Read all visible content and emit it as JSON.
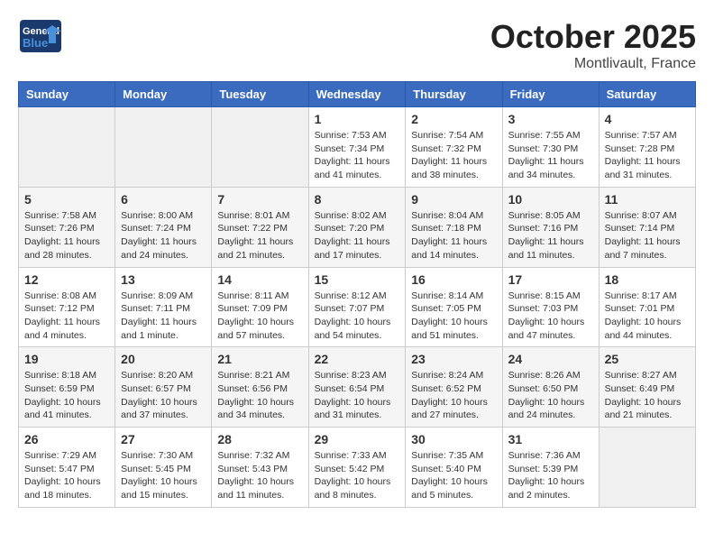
{
  "header": {
    "logo": {
      "general": "General",
      "blue": "Blue"
    },
    "title": "October 2025",
    "location": "Montlivault, France"
  },
  "weekdays": [
    "Sunday",
    "Monday",
    "Tuesday",
    "Wednesday",
    "Thursday",
    "Friday",
    "Saturday"
  ],
  "weeks": [
    [
      {
        "day": "",
        "info": ""
      },
      {
        "day": "",
        "info": ""
      },
      {
        "day": "",
        "info": ""
      },
      {
        "day": "1",
        "info": "Sunrise: 7:53 AM\nSunset: 7:34 PM\nDaylight: 11 hours\nand 41 minutes."
      },
      {
        "day": "2",
        "info": "Sunrise: 7:54 AM\nSunset: 7:32 PM\nDaylight: 11 hours\nand 38 minutes."
      },
      {
        "day": "3",
        "info": "Sunrise: 7:55 AM\nSunset: 7:30 PM\nDaylight: 11 hours\nand 34 minutes."
      },
      {
        "day": "4",
        "info": "Sunrise: 7:57 AM\nSunset: 7:28 PM\nDaylight: 11 hours\nand 31 minutes."
      }
    ],
    [
      {
        "day": "5",
        "info": "Sunrise: 7:58 AM\nSunset: 7:26 PM\nDaylight: 11 hours\nand 28 minutes."
      },
      {
        "day": "6",
        "info": "Sunrise: 8:00 AM\nSunset: 7:24 PM\nDaylight: 11 hours\nand 24 minutes."
      },
      {
        "day": "7",
        "info": "Sunrise: 8:01 AM\nSunset: 7:22 PM\nDaylight: 11 hours\nand 21 minutes."
      },
      {
        "day": "8",
        "info": "Sunrise: 8:02 AM\nSunset: 7:20 PM\nDaylight: 11 hours\nand 17 minutes."
      },
      {
        "day": "9",
        "info": "Sunrise: 8:04 AM\nSunset: 7:18 PM\nDaylight: 11 hours\nand 14 minutes."
      },
      {
        "day": "10",
        "info": "Sunrise: 8:05 AM\nSunset: 7:16 PM\nDaylight: 11 hours\nand 11 minutes."
      },
      {
        "day": "11",
        "info": "Sunrise: 8:07 AM\nSunset: 7:14 PM\nDaylight: 11 hours\nand 7 minutes."
      }
    ],
    [
      {
        "day": "12",
        "info": "Sunrise: 8:08 AM\nSunset: 7:12 PM\nDaylight: 11 hours\nand 4 minutes."
      },
      {
        "day": "13",
        "info": "Sunrise: 8:09 AM\nSunset: 7:11 PM\nDaylight: 11 hours\nand 1 minute."
      },
      {
        "day": "14",
        "info": "Sunrise: 8:11 AM\nSunset: 7:09 PM\nDaylight: 10 hours\nand 57 minutes."
      },
      {
        "day": "15",
        "info": "Sunrise: 8:12 AM\nSunset: 7:07 PM\nDaylight: 10 hours\nand 54 minutes."
      },
      {
        "day": "16",
        "info": "Sunrise: 8:14 AM\nSunset: 7:05 PM\nDaylight: 10 hours\nand 51 minutes."
      },
      {
        "day": "17",
        "info": "Sunrise: 8:15 AM\nSunset: 7:03 PM\nDaylight: 10 hours\nand 47 minutes."
      },
      {
        "day": "18",
        "info": "Sunrise: 8:17 AM\nSunset: 7:01 PM\nDaylight: 10 hours\nand 44 minutes."
      }
    ],
    [
      {
        "day": "19",
        "info": "Sunrise: 8:18 AM\nSunset: 6:59 PM\nDaylight: 10 hours\nand 41 minutes."
      },
      {
        "day": "20",
        "info": "Sunrise: 8:20 AM\nSunset: 6:57 PM\nDaylight: 10 hours\nand 37 minutes."
      },
      {
        "day": "21",
        "info": "Sunrise: 8:21 AM\nSunset: 6:56 PM\nDaylight: 10 hours\nand 34 minutes."
      },
      {
        "day": "22",
        "info": "Sunrise: 8:23 AM\nSunset: 6:54 PM\nDaylight: 10 hours\nand 31 minutes."
      },
      {
        "day": "23",
        "info": "Sunrise: 8:24 AM\nSunset: 6:52 PM\nDaylight: 10 hours\nand 27 minutes."
      },
      {
        "day": "24",
        "info": "Sunrise: 8:26 AM\nSunset: 6:50 PM\nDaylight: 10 hours\nand 24 minutes."
      },
      {
        "day": "25",
        "info": "Sunrise: 8:27 AM\nSunset: 6:49 PM\nDaylight: 10 hours\nand 21 minutes."
      }
    ],
    [
      {
        "day": "26",
        "info": "Sunrise: 7:29 AM\nSunset: 5:47 PM\nDaylight: 10 hours\nand 18 minutes."
      },
      {
        "day": "27",
        "info": "Sunrise: 7:30 AM\nSunset: 5:45 PM\nDaylight: 10 hours\nand 15 minutes."
      },
      {
        "day": "28",
        "info": "Sunrise: 7:32 AM\nSunset: 5:43 PM\nDaylight: 10 hours\nand 11 minutes."
      },
      {
        "day": "29",
        "info": "Sunrise: 7:33 AM\nSunset: 5:42 PM\nDaylight: 10 hours\nand 8 minutes."
      },
      {
        "day": "30",
        "info": "Sunrise: 7:35 AM\nSunset: 5:40 PM\nDaylight: 10 hours\nand 5 minutes."
      },
      {
        "day": "31",
        "info": "Sunrise: 7:36 AM\nSunset: 5:39 PM\nDaylight: 10 hours\nand 2 minutes."
      },
      {
        "day": "",
        "info": ""
      }
    ]
  ]
}
